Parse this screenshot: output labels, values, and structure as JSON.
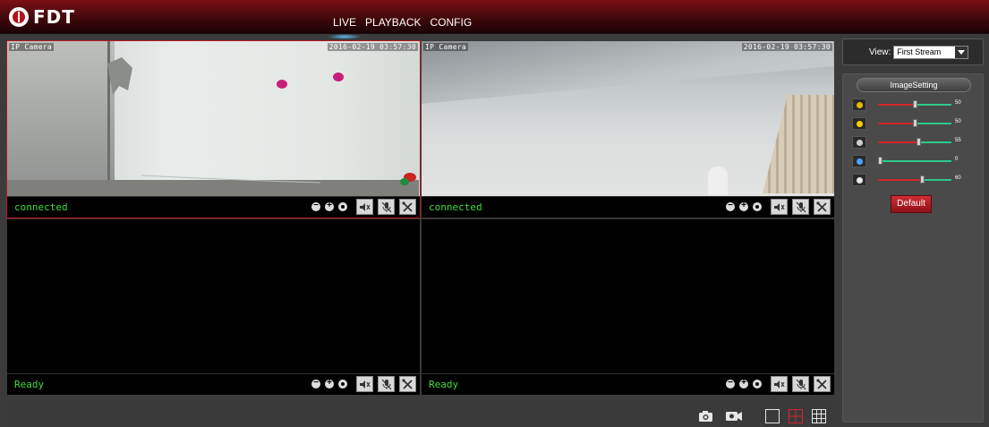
{
  "header": {
    "logo_text": "FDT",
    "nav": [
      {
        "label": "LIVE",
        "active": true
      },
      {
        "label": "PLAYBACK",
        "active": false
      },
      {
        "label": "CONFIG",
        "active": false
      }
    ]
  },
  "panes": [
    {
      "status": "connected",
      "osd_name": "IP Camera",
      "osd_time": "2016-02-19 03:57:30",
      "selected": true
    },
    {
      "status": "connected",
      "osd_name": "IP Camera",
      "osd_time": "2016-02-19 03:57:30",
      "selected": false
    },
    {
      "status": "Ready",
      "selected": false
    },
    {
      "status": "Ready",
      "selected": false
    }
  ],
  "view": {
    "label": "View:",
    "selected": "First Stream"
  },
  "image_setting": {
    "title": "ImageSetting",
    "sliders": [
      {
        "icon": "color-saturation-icon",
        "value": "50",
        "fraction": 0.5
      },
      {
        "icon": "brightness-icon",
        "value": "50",
        "fraction": 0.5
      },
      {
        "icon": "contrast-icon",
        "value": "55",
        "fraction": 0.55
      },
      {
        "icon": "hue-icon",
        "value": "0",
        "fraction": 0.0
      },
      {
        "icon": "sharpness-icon",
        "value": "60",
        "fraction": 0.6
      }
    ],
    "default_label": "Default"
  },
  "colors": {
    "accent": "#b5121b",
    "status_green": "#3ede3a",
    "slider_left": "#d6242b",
    "slider_right": "#2ec98c"
  }
}
